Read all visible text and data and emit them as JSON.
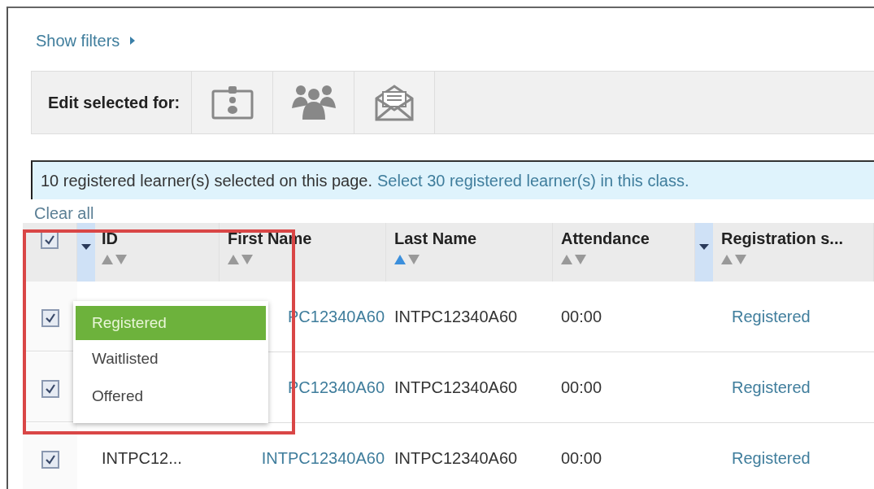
{
  "filters_link": {
    "label": "Show filters"
  },
  "toolbar": {
    "label": "Edit selected for:"
  },
  "selection_banner": {
    "text": "10 registered learner(s) selected on this page.",
    "link": "Select 30 registered learner(s) in this class."
  },
  "clear_all": {
    "label": "Clear all"
  },
  "table": {
    "select_all": {
      "checked": true
    },
    "columns": [
      {
        "label": "ID",
        "filter": true,
        "sorted_ascending": false
      },
      {
        "label": "First Name",
        "filter": false,
        "sorted_ascending": false
      },
      {
        "label": "Last Name",
        "filter": false,
        "sorted_ascending": true
      },
      {
        "label": "Attendance",
        "filter": false,
        "sorted_ascending": false
      },
      {
        "label": "Registration s...",
        "filter": true,
        "sorted_ascending": false
      }
    ],
    "rows": [
      {
        "checked": true,
        "first_name": "PC12340A60",
        "last_name": "INTPC12340A60",
        "attendance": "00:00",
        "status": "Registered"
      },
      {
        "checked": true,
        "first_name": "PC12340A60",
        "last_name": "INTPC12340A60",
        "attendance": "00:00",
        "status": "Registered"
      },
      {
        "checked": true,
        "id": "INTPC12...",
        "first_name": "INTPC12340A60",
        "last_name": "INTPC12340A60",
        "attendance": "00:00",
        "status": "Registered"
      }
    ]
  },
  "filter_menu": {
    "options": [
      {
        "label": "Registered",
        "selected": true
      },
      {
        "label": "Waitlisted",
        "selected": false
      },
      {
        "label": "Offered",
        "selected": false
      }
    ]
  }
}
